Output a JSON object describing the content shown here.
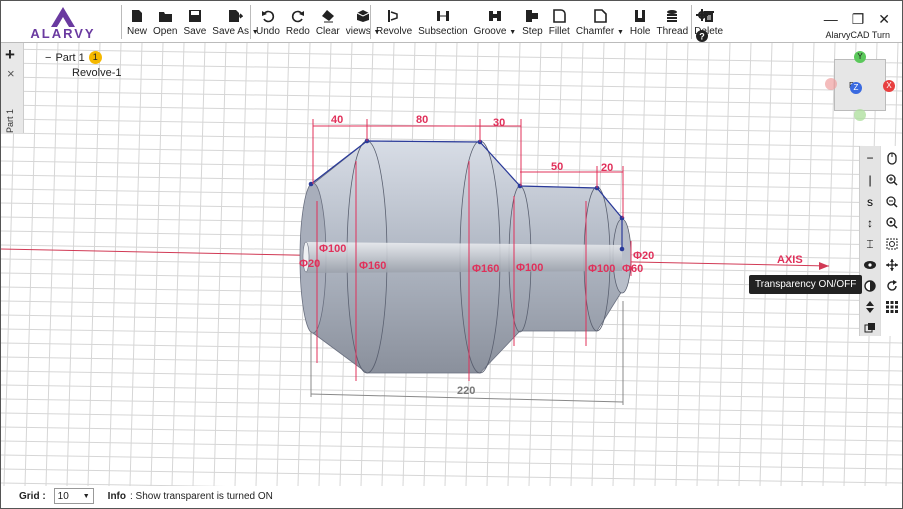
{
  "app": {
    "logo_text": "ALARVY",
    "title": "AlarvyCAD Turn"
  },
  "toolbar": {
    "file": [
      {
        "label": "New",
        "icon": "new-file-icon"
      },
      {
        "label": "Open",
        "icon": "open-folder-icon"
      },
      {
        "label": "Save",
        "icon": "save-icon"
      },
      {
        "label": "Save As",
        "icon": "save-as-icon",
        "dropdown": true
      }
    ],
    "edit": [
      {
        "label": "Undo",
        "icon": "undo-icon"
      },
      {
        "label": "Redo",
        "icon": "redo-icon"
      },
      {
        "label": "Clear",
        "icon": "eraser-icon"
      },
      {
        "label": "views",
        "icon": "cube-icon",
        "dropdown": true
      }
    ],
    "ops": [
      {
        "label": "Revolve",
        "icon": "revolve-icon"
      },
      {
        "label": "Subsection",
        "icon": "subsection-icon"
      },
      {
        "label": "Groove",
        "icon": "groove-icon",
        "dropdown": true
      },
      {
        "label": "Step",
        "icon": "step-icon"
      },
      {
        "label": "Fillet",
        "icon": "fillet-icon"
      },
      {
        "label": "Chamfer",
        "icon": "chamfer-icon",
        "dropdown": true
      },
      {
        "label": "Hole",
        "icon": "hole-icon"
      },
      {
        "label": "Thread",
        "icon": "thread-icon"
      },
      {
        "label": "Delete",
        "icon": "trash-icon"
      }
    ]
  },
  "left_panel": {
    "add_label": "+",
    "close_label": "×",
    "tab_label": "Part 1"
  },
  "tree": {
    "root_toggle": "−",
    "root_label": "Part 1",
    "root_badge": "1",
    "child_label": "Revolve-1"
  },
  "viewcube": {
    "y_label": "Y",
    "x_label": "X",
    "z_label": "Z",
    "face_label": "P"
  },
  "right_toolbar": {
    "left_col": [
      "−",
      "|",
      "s",
      "↕",
      "⌶",
      "👁",
      "◐",
      "⇕"
    ],
    "tooltip": "Transparency ON/OFF"
  },
  "drawing": {
    "axis_label": "AXIS",
    "dims_top": [
      "40",
      "80",
      "30",
      "50",
      "20"
    ],
    "dims_dia": [
      "Φ100",
      "Φ20",
      "Φ160",
      "Φ160",
      "Φ100",
      "Φ100",
      "Φ20",
      "Φ60"
    ],
    "overall_length": "220"
  },
  "status": {
    "grid_label": "Grid :",
    "grid_value": "10",
    "info_label": "Info",
    "info_text": ": Show transparent is turned ON"
  },
  "colors": {
    "accent": "#e0305a",
    "grid": "#d5d5d5",
    "body": "#aab2c0",
    "edge": "#2a3a9a"
  }
}
